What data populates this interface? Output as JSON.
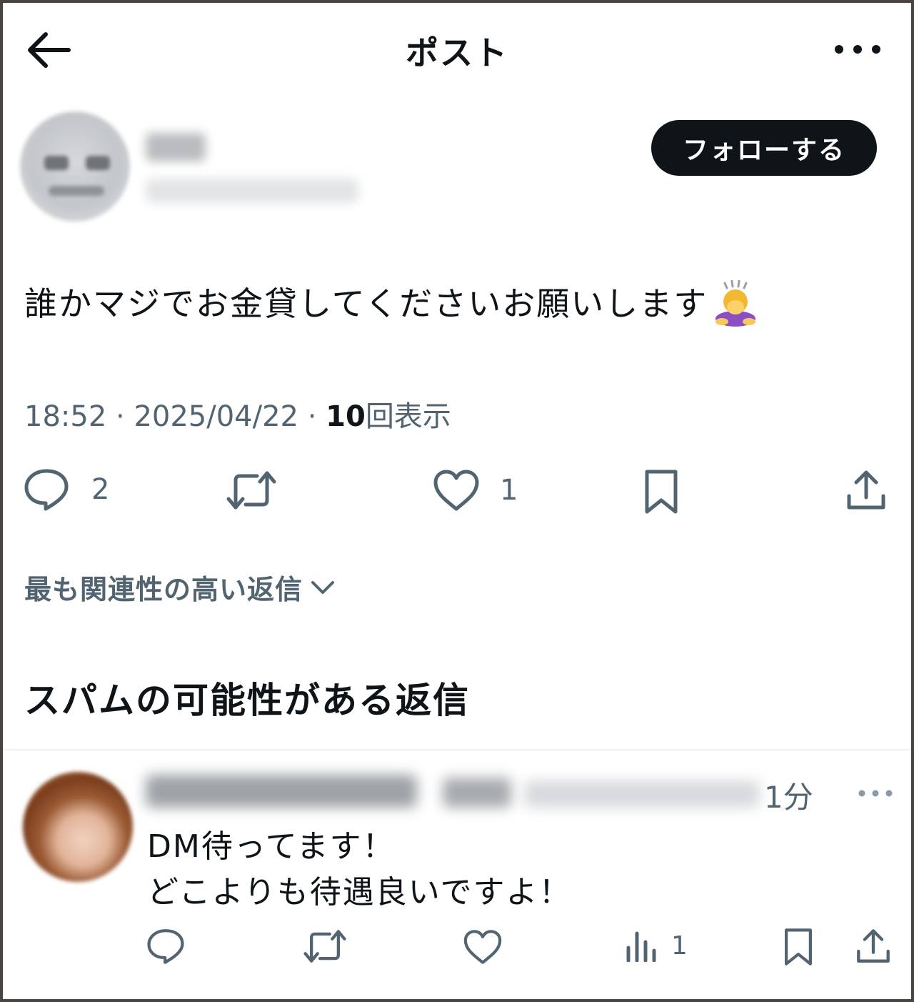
{
  "header": {
    "title": "ポスト"
  },
  "author": {
    "follow_label": "フォローする"
  },
  "post": {
    "text": "誰かマジでお金貸してくださいお願いします",
    "time": "18:52",
    "sep1": " · ",
    "date": "2025/04/22",
    "sep2": " · ",
    "views_count": "10",
    "views_label": "回表示",
    "reply_count": "2",
    "like_count": "1"
  },
  "replies_sort": {
    "label": "最も関連性の高い返信"
  },
  "spam_section": {
    "heading": "スパムの可能性がある返信"
  },
  "reply": {
    "time": "1分",
    "line1": "DM待ってます！",
    "line2": "どこよりも待遇良いですよ！",
    "views_count": "1"
  },
  "colors": {
    "text": "#0f1419",
    "secondary": "#536471",
    "follow_bg": "#0f1419",
    "divider": "#eff3f4"
  },
  "icons": [
    "back-arrow-icon",
    "more-icon",
    "reply-icon",
    "repost-icon",
    "like-icon",
    "bookmark-icon",
    "share-icon",
    "views-icon",
    "chevron-down-icon",
    "bowing-person-emoji"
  ]
}
